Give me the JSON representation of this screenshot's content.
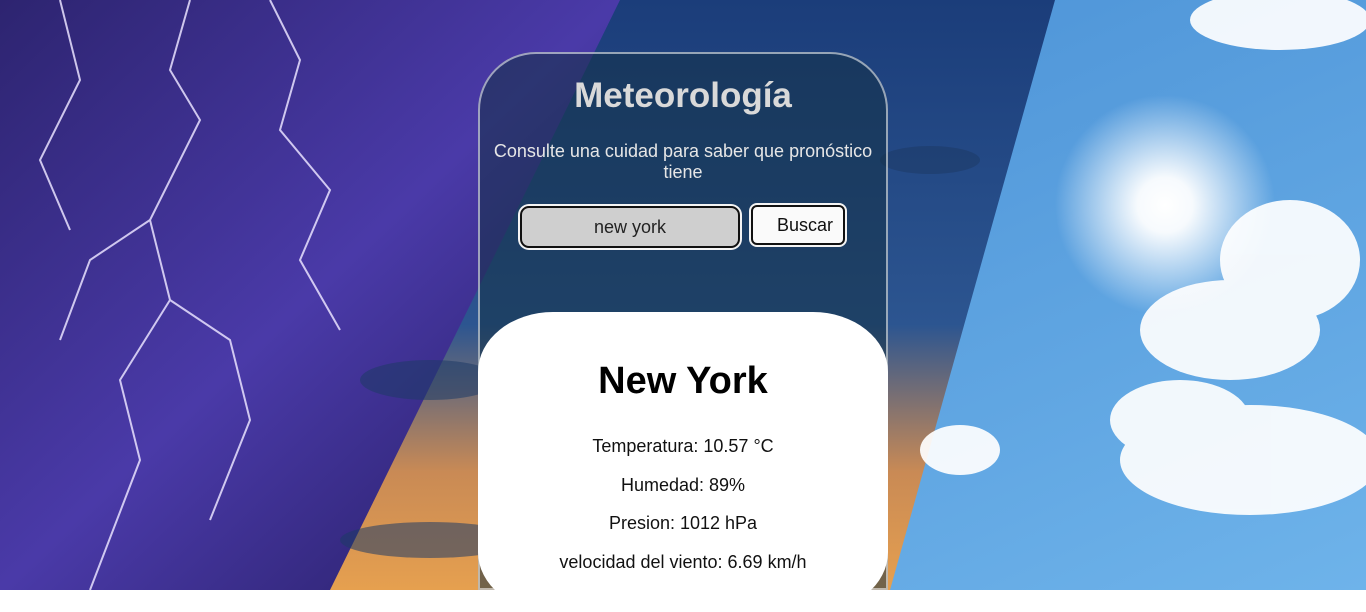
{
  "app": {
    "title": "Meteorología",
    "subtitle": "Consulte una cuidad para saber que pronóstico tiene"
  },
  "search": {
    "value": "new york",
    "button_label": "Buscar"
  },
  "result": {
    "city": "New York",
    "temperature": "Temperatura: 10.57 °C",
    "humidity": "Humedad: 89%",
    "pressure": "Presion: 1012 hPa",
    "wind": "velocidad del viento: 6.69 km/h"
  },
  "colors": {
    "storm": "#3a2a8f",
    "sky": "#2f6fb8",
    "sun_sky": "#4f9ee6",
    "card_bg": "#14323f",
    "result_bg": "#ffffff"
  },
  "icons": {
    "background": "weather-collage-image"
  }
}
